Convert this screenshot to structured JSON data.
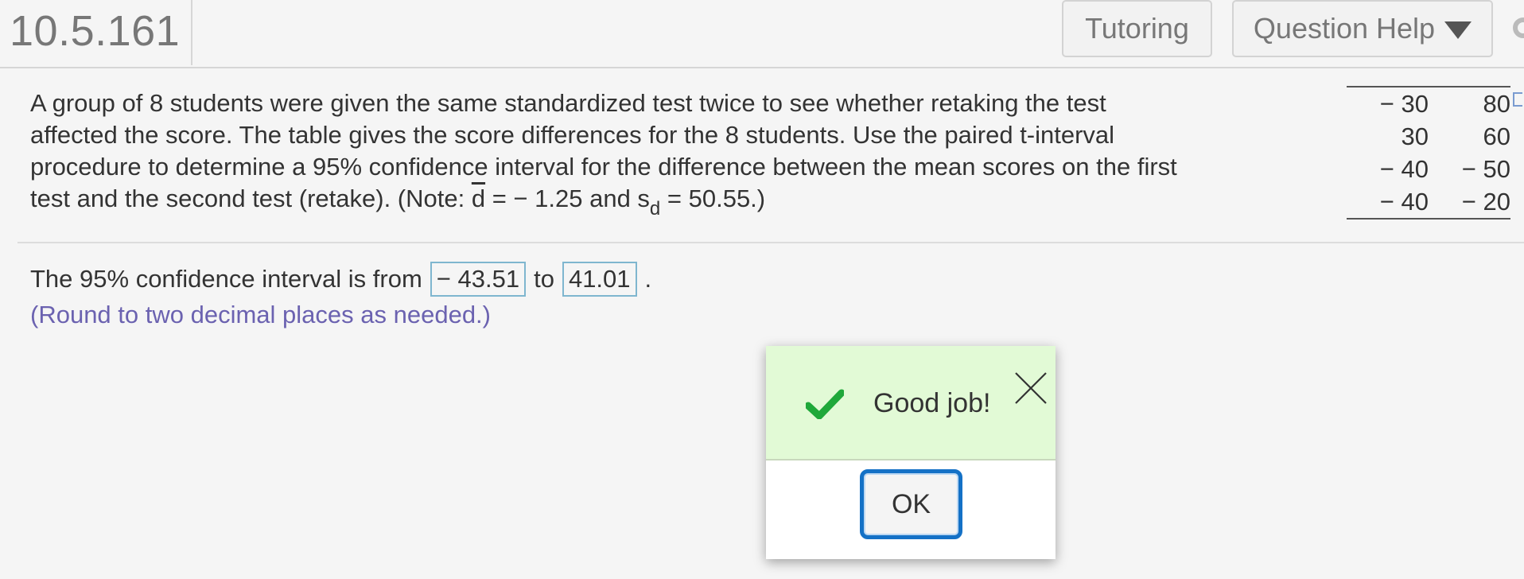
{
  "header": {
    "question_number": "10.5.161",
    "tutoring_label": "Tutoring",
    "question_help_label": "Question Help"
  },
  "problem": {
    "line1": "A group of 8 students were given the same standardized test twice to see whether retaking the test",
    "line2": "affected the score. The table gives the score differences for the 8 students. Use the paired t-interval",
    "line3": "procedure to determine a 95% confidence interval for the difference between the mean scores on the first",
    "line4_prefix": "test and the second test (retake).  (Note: ",
    "dbar_symbol": "d",
    "line4_mid": " = − 1.25 and s",
    "sd_subscript": "d",
    "line4_suffix": " = 50.55.)"
  },
  "data_table": {
    "rows": [
      [
        "− 30",
        "80"
      ],
      [
        "30",
        "60"
      ],
      [
        "− 40",
        "− 50"
      ],
      [
        "− 40",
        "− 20"
      ]
    ]
  },
  "answer": {
    "prefix": "The 95% confidence interval is from",
    "lower_value": "− 43.51",
    "connector": "to",
    "upper_value": "41.01",
    "suffix": ".",
    "hint": "(Round to two decimal places as needed.)"
  },
  "feedback_modal": {
    "message": "Good job!",
    "ok_label": "OK",
    "check_color": "#1fa83a",
    "background_color": "#e2fad6"
  },
  "colors": {
    "hint_text": "#6b62b0",
    "answer_box_border": "#7fb6cf",
    "ok_button_border": "#1471c6"
  }
}
